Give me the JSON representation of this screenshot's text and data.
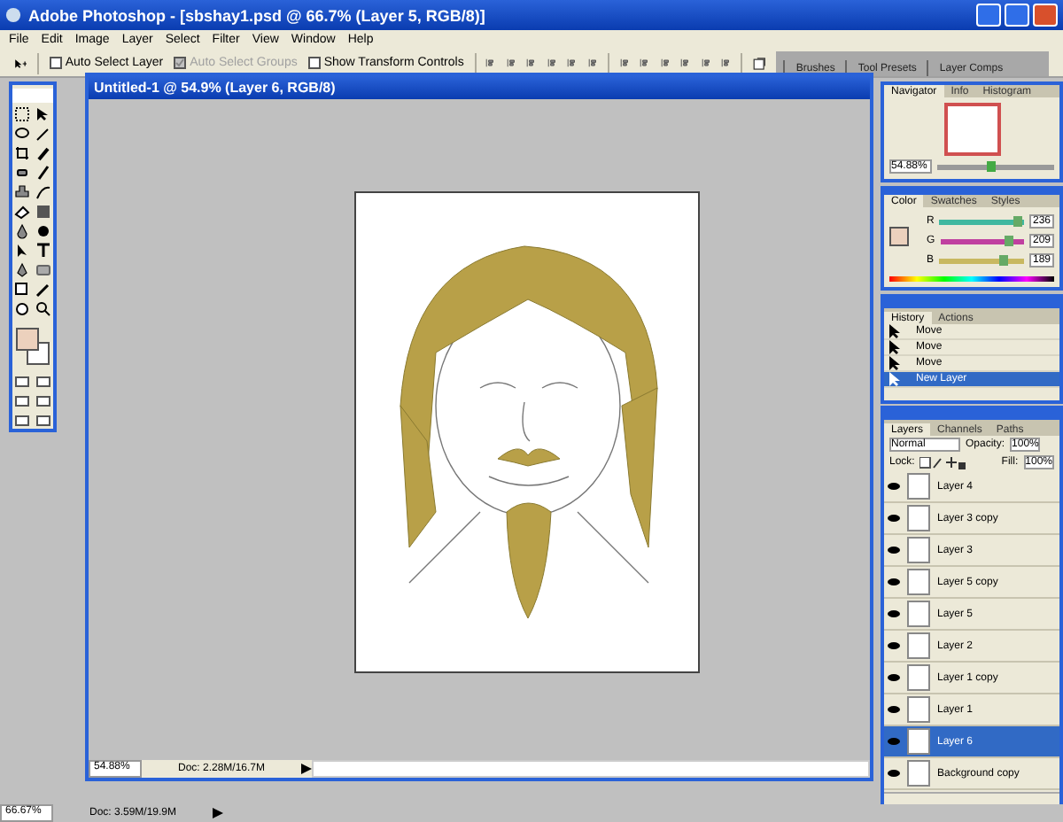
{
  "window": {
    "title": "Adobe Photoshop - [sbshay1.psd @ 66.7% (Layer 5, RGB/8)]"
  },
  "menu": [
    "File",
    "Edit",
    "Image",
    "Layer",
    "Select",
    "Filter",
    "View",
    "Window",
    "Help"
  ],
  "options_bar": {
    "checkboxes": [
      {
        "label": "Auto Select Layer",
        "checked": false,
        "disabled": false
      },
      {
        "label": "Auto Select Groups",
        "checked": true,
        "disabled": true
      },
      {
        "label": "Show Transform Controls",
        "checked": false,
        "disabled": false
      }
    ],
    "palette_tabs": [
      "Brushes",
      "Tool Presets",
      "Layer Comps"
    ]
  },
  "document": {
    "title": "Untitled-1 @ 54.9% (Layer 6, RGB/8)",
    "zoom": "54.88%",
    "doc_info": "Doc: 2.28M/16.7M"
  },
  "navigator": {
    "tabs": [
      {
        "label": "Navigator",
        "selected": true
      },
      {
        "label": "Info",
        "selected": false
      },
      {
        "label": "Histogram",
        "selected": false
      }
    ],
    "zoom": "54.88%",
    "level": 0.45
  },
  "color": {
    "tabs": [
      {
        "label": "Color",
        "selected": true
      },
      {
        "label": "Swatches",
        "selected": false
      },
      {
        "label": "Styles",
        "selected": false
      }
    ],
    "sliders": [
      {
        "label": "R",
        "level": 0.925,
        "value": "236",
        "color": "#40b8a0"
      },
      {
        "label": "G",
        "level": 0.82,
        "value": "209",
        "color": "#c040a0"
      },
      {
        "label": "B",
        "level": 0.74,
        "value": "189",
        "color": "#c8b860"
      }
    ]
  },
  "history": {
    "tabs": [
      {
        "label": "History",
        "selected": true
      },
      {
        "label": "Actions",
        "selected": false
      }
    ],
    "items": [
      {
        "label": "Move",
        "selected": false
      },
      {
        "label": "Move",
        "selected": false
      },
      {
        "label": "Move",
        "selected": false
      },
      {
        "label": "New Layer",
        "selected": true
      }
    ]
  },
  "layers": {
    "tabs": [
      {
        "label": "Layers",
        "selected": true
      },
      {
        "label": "Channels",
        "selected": false
      },
      {
        "label": "Paths",
        "selected": false
      }
    ],
    "blend_mode": "Normal",
    "opacity_label": "Opacity:",
    "opacity": "100%",
    "lock_label": "Lock:",
    "fill_label": "Fill:",
    "fill": "100%",
    "items": [
      {
        "name": "Layer 4",
        "selected": false,
        "visible": true
      },
      {
        "name": "Layer 3 copy",
        "selected": false,
        "visible": true
      },
      {
        "name": "Layer 3",
        "selected": false,
        "visible": true
      },
      {
        "name": "Layer 5 copy",
        "selected": false,
        "visible": true
      },
      {
        "name": "Layer 5",
        "selected": false,
        "visible": true
      },
      {
        "name": "Layer 2",
        "selected": false,
        "visible": true
      },
      {
        "name": "Layer 1 copy",
        "selected": false,
        "visible": true
      },
      {
        "name": "Layer 1",
        "selected": false,
        "visible": true
      },
      {
        "name": "Layer 6",
        "selected": true,
        "visible": true
      },
      {
        "name": "Background copy",
        "selected": false,
        "visible": true
      }
    ]
  },
  "status_bar": {
    "zoom": "66.67%",
    "doc_info": "Doc: 3.59M/19.9M"
  }
}
